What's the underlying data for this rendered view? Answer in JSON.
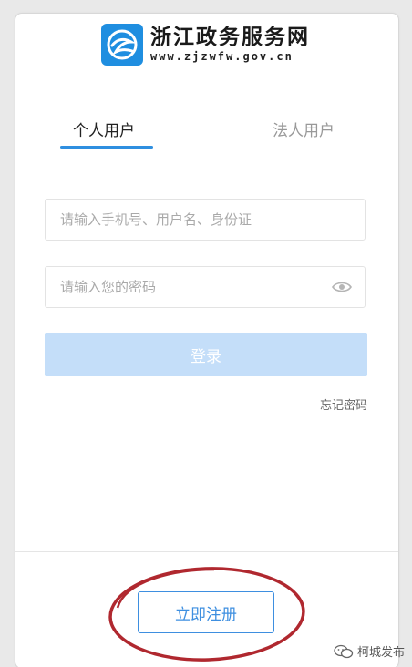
{
  "brand": {
    "name": "浙江政务服务网",
    "url": "www.zjzwfw.gov.cn"
  },
  "tabs": [
    {
      "label": "个人用户",
      "active": true
    },
    {
      "label": "法人用户",
      "active": false
    }
  ],
  "form": {
    "username_placeholder": "请输入手机号、用户名、身份证",
    "password_placeholder": "请输入您的密码",
    "login_label": "登录",
    "forgot_label": "忘记密码"
  },
  "register": {
    "label": "立即注册"
  },
  "watermark": {
    "text": "柯城发布"
  },
  "colors": {
    "accent": "#2f8fe0",
    "login_disabled": "#c4def9",
    "annotation": "#b0282f"
  },
  "icons": {
    "logo": "zjzwfw-logo-icon",
    "eye": "eye-icon",
    "watermark": "wechat-icon"
  }
}
